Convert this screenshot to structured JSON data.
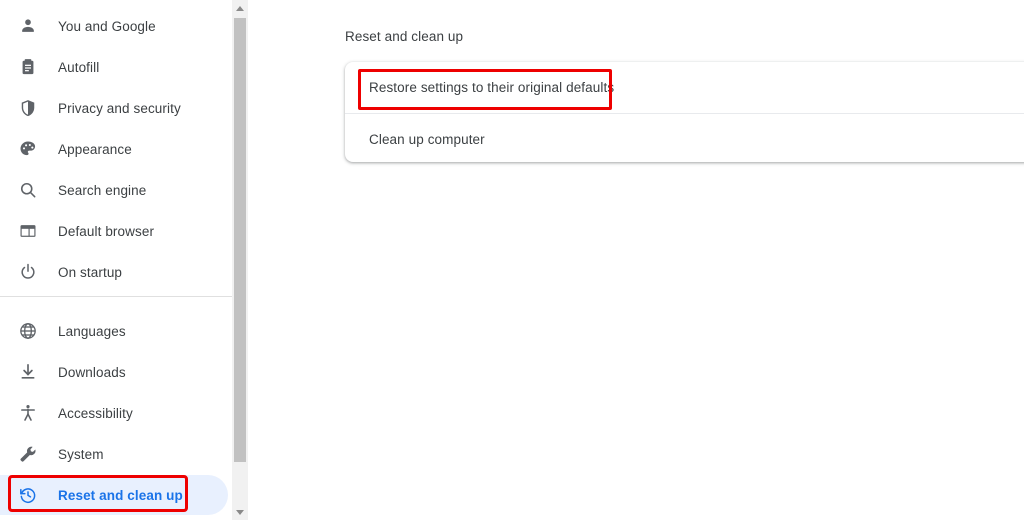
{
  "theme": {
    "accent": "#1a73e8",
    "selected_bg": "#e8f0fe",
    "text": "#3c4043",
    "icon": "#5f6368",
    "annotation": "#ee0000",
    "scrollbar_thumb": "#c1c1c1",
    "scrollbar_track": "#f1f1f1"
  },
  "sidebar": {
    "items": [
      {
        "label": "You and Google",
        "icon": "person-icon",
        "selected": false
      },
      {
        "label": "Autofill",
        "icon": "clipboard-icon",
        "selected": false
      },
      {
        "label": "Privacy and security",
        "icon": "shield-icon",
        "selected": false
      },
      {
        "label": "Appearance",
        "icon": "palette-icon",
        "selected": false
      },
      {
        "label": "Search engine",
        "icon": "search-icon",
        "selected": false
      },
      {
        "label": "Default browser",
        "icon": "browser-window-icon",
        "selected": false
      },
      {
        "label": "On startup",
        "icon": "power-icon",
        "selected": false
      },
      {
        "label": "Languages",
        "icon": "globe-icon",
        "selected": false
      },
      {
        "label": "Downloads",
        "icon": "download-icon",
        "selected": false
      },
      {
        "label": "Accessibility",
        "icon": "accessibility-icon",
        "selected": false
      },
      {
        "label": "System",
        "icon": "wrench-icon",
        "selected": false
      },
      {
        "label": "Reset and clean up",
        "icon": "history-restore-icon",
        "selected": true
      }
    ]
  },
  "scrollbar": {
    "up_arrow": "scroll-up-arrow-icon",
    "down_arrow": "scroll-down-arrow-icon"
  },
  "main": {
    "section_title": "Reset and clean up",
    "rows": [
      {
        "label": "Restore settings to their original defaults",
        "chevron": "chevron-right-icon"
      },
      {
        "label": "Clean up computer",
        "chevron": "chevron-right-icon"
      }
    ]
  },
  "annotations": [
    {
      "name": "restore-settings-highlight",
      "target": "Restore settings to their original defaults"
    },
    {
      "name": "reset-and-clean-up-highlight",
      "target": "Reset and clean up"
    }
  ]
}
